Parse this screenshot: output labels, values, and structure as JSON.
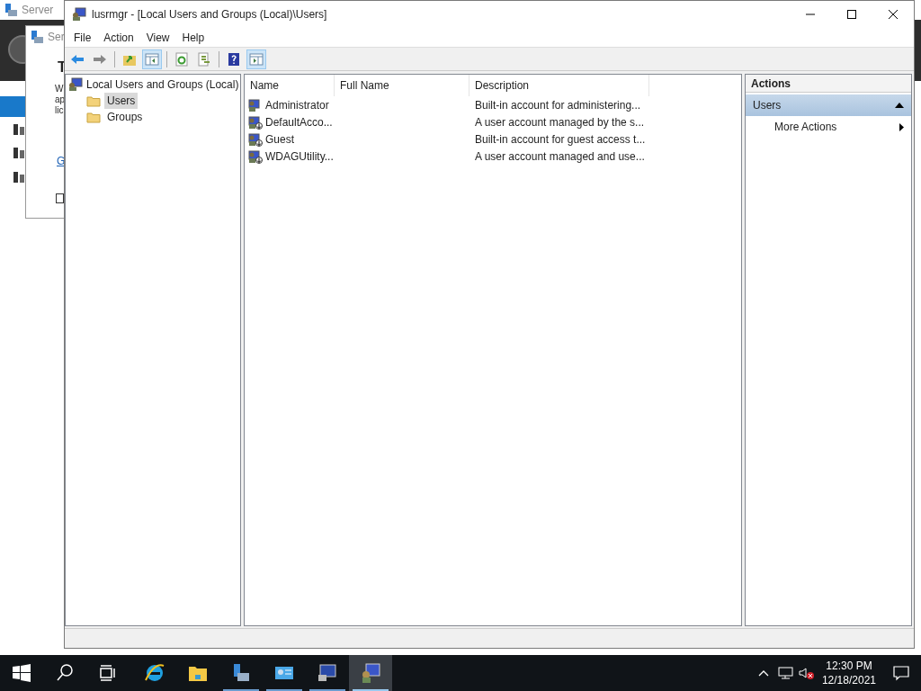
{
  "background": {
    "title": "Server",
    "checkbox_checked": false,
    "dialog_title": "Ser",
    "dialog_heading": "T",
    "dialog_lines": [
      "W",
      "ap",
      "lic"
    ],
    "dialog_link": "G"
  },
  "window": {
    "title": "lusrmgr - [Local Users and Groups (Local)\\Users]"
  },
  "menu": [
    "File",
    "Action",
    "View",
    "Help"
  ],
  "toolbar": [
    {
      "kind": "back",
      "selected": false
    },
    {
      "kind": "forward",
      "selected": false
    },
    {
      "kind": "sep"
    },
    {
      "kind": "up",
      "selected": false
    },
    {
      "kind": "tree",
      "selected": true
    },
    {
      "kind": "sep"
    },
    {
      "kind": "refresh",
      "selected": false
    },
    {
      "kind": "export",
      "selected": false
    },
    {
      "kind": "sep"
    },
    {
      "kind": "help",
      "selected": false
    },
    {
      "kind": "actionpane",
      "selected": true
    }
  ],
  "tree": {
    "label": "Local Users and Groups (Local)",
    "children": [
      {
        "label": "Users",
        "selected": true
      },
      {
        "label": "Groups",
        "selected": false
      }
    ]
  },
  "table": {
    "columns": [
      "Name",
      "Full Name",
      "Description"
    ],
    "rows": [
      {
        "name": "Administrator",
        "description": "Built-in account for administering...",
        "disabled": false
      },
      {
        "name": "DefaultAcco...",
        "description": "A user account managed by the s...",
        "disabled": true
      },
      {
        "name": "Guest",
        "description": "Built-in account for guest access t...",
        "disabled": true
      },
      {
        "name": "WDAGUtility...",
        "description": "A user account managed and use...",
        "disabled": true
      }
    ]
  },
  "actions": {
    "title": "Actions",
    "section": "Users",
    "expanded": true,
    "items": [
      "More Actions"
    ]
  },
  "taskbar": [
    {
      "kind": "ie",
      "active": false,
      "running": false
    },
    {
      "kind": "folder",
      "active": false,
      "running": false
    },
    {
      "kind": "server",
      "active": false,
      "running": true
    },
    {
      "kind": "panel",
      "active": false,
      "running": true
    },
    {
      "kind": "monitor",
      "active": false,
      "running": true
    },
    {
      "kind": "users",
      "active": true,
      "running": true
    }
  ],
  "clock": {
    "time": "12:30 PM",
    "date": "12/18/2021"
  }
}
